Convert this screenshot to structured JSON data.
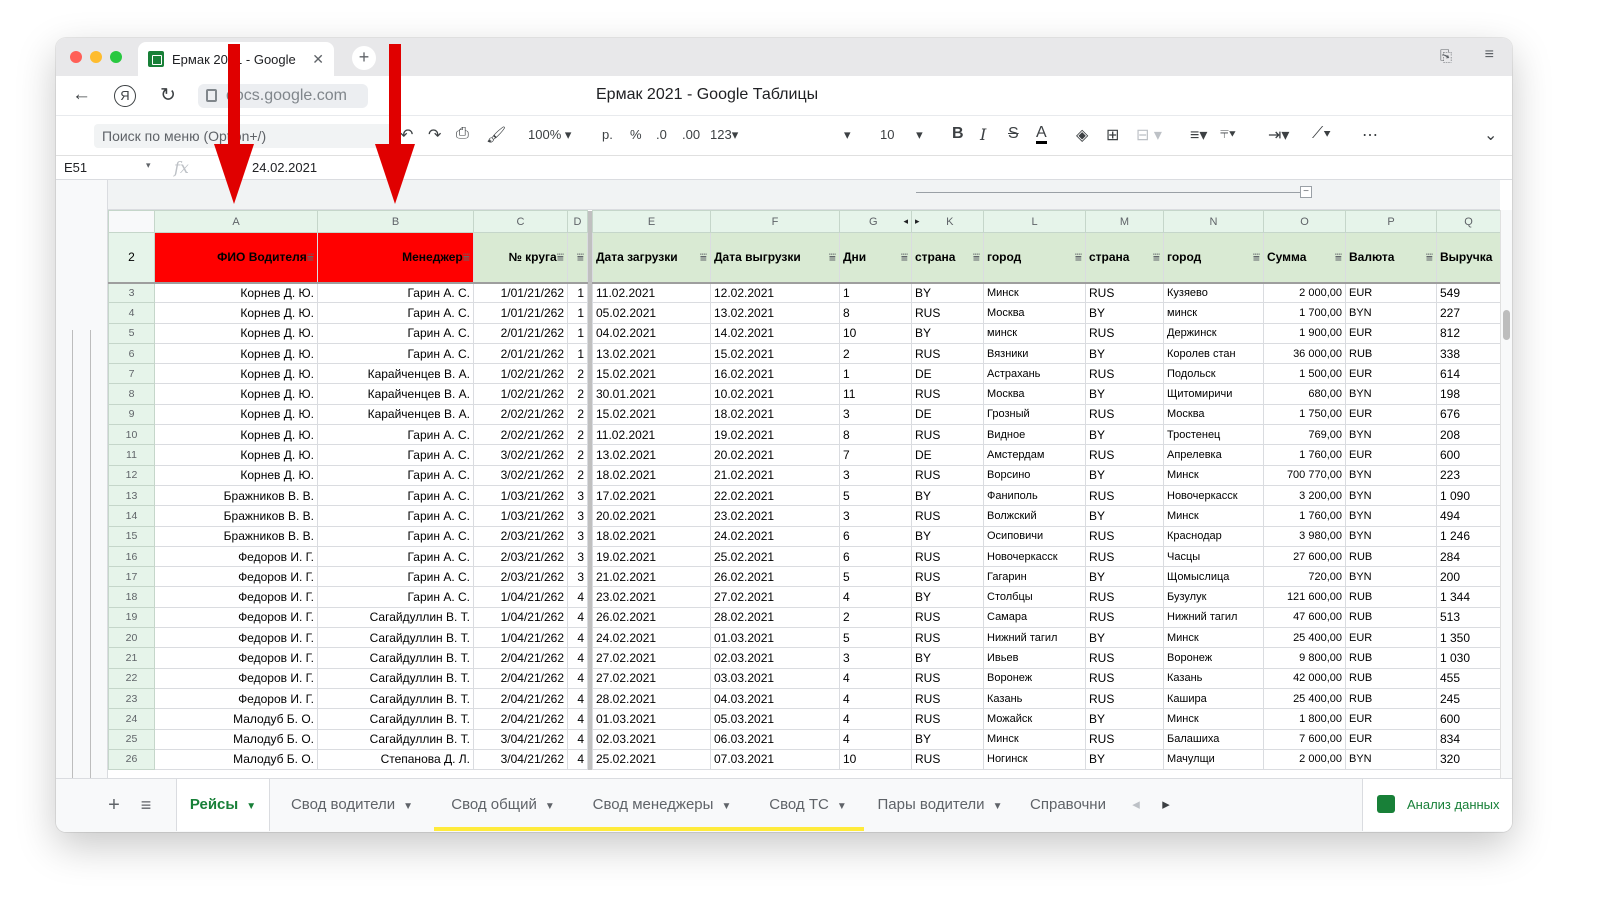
{
  "browser": {
    "tab_title": "Ермак 2021 - Google",
    "url": "docs.google.com",
    "page_title": "Ермак 2021 - Google Таблицы"
  },
  "toolbar": {
    "menu_search_placeholder": "Поиск по меню (Option+/)",
    "zoom": "100%",
    "currency": "р.",
    "percent": "%",
    "dec_decrease": ".0",
    "dec_increase": ".00",
    "number_format": "123",
    "font_size": "10"
  },
  "formula_bar": {
    "cell_ref": "E51",
    "fx": "fx",
    "value": "24.02.2021"
  },
  "colors": {
    "accent": "#188038",
    "highlight_header": "#ff0000",
    "header_fill": "#d9ead3",
    "arrow": "#e00000"
  },
  "sheet": {
    "columns": [
      "A",
      "B",
      "C",
      "D",
      "E",
      "F",
      "G",
      "K",
      "L",
      "M",
      "N",
      "O",
      "P",
      "Q"
    ],
    "headers": [
      "ФИО Водителя",
      "Менеджер",
      "№ круга",
      "",
      "Дата загрузки",
      "Дата выгрузки",
      "Дни",
      "страна",
      "город",
      "страна",
      "город",
      "Сумма",
      "Валюта",
      "Выручка"
    ],
    "header_row_number": "2",
    "rows": [
      {
        "n": "3",
        "a": "Корнев Д. Ю.",
        "b": "Гарин А. С.",
        "c": "1/01/21/262",
        "d": "1",
        "e": "11.02.2021",
        "f": "12.02.2021",
        "g": "1",
        "k": "BY",
        "l": "Минск",
        "m": "RUS",
        "nn": "Кузяево",
        "o": "2 000,00",
        "p": "EUR",
        "q": "549"
      },
      {
        "n": "4",
        "a": "Корнев Д. Ю.",
        "b": "Гарин А. С.",
        "c": "1/01/21/262",
        "d": "1",
        "e": "05.02.2021",
        "f": "13.02.2021",
        "g": "8",
        "k": "RUS",
        "l": "Москва",
        "m": "BY",
        "nn": "минск",
        "o": "1 700,00",
        "p": "BYN",
        "q": "227"
      },
      {
        "n": "5",
        "a": "Корнев Д. Ю.",
        "b": "Гарин А. С.",
        "c": "2/01/21/262",
        "d": "1",
        "e": "04.02.2021",
        "f": "14.02.2021",
        "g": "10",
        "k": "BY",
        "l": "минск",
        "m": "RUS",
        "nn": "Держинск",
        "o": "1 900,00",
        "p": "EUR",
        "q": "812"
      },
      {
        "n": "6",
        "a": "Корнев Д. Ю.",
        "b": "Гарин А. С.",
        "c": "2/01/21/262",
        "d": "1",
        "e": "13.02.2021",
        "f": "15.02.2021",
        "g": "2",
        "k": "RUS",
        "l": "Вязники",
        "m": "BY",
        "nn": "Королев стан",
        "o": "36 000,00",
        "p": "RUB",
        "q": "338"
      },
      {
        "n": "7",
        "a": "Корнев Д. Ю.",
        "b": "Карайченцев В. А.",
        "c": "1/02/21/262",
        "d": "2",
        "e": "15.02.2021",
        "f": "16.02.2021",
        "g": "1",
        "k": "DE",
        "l": "Астрахань",
        "m": "RUS",
        "nn": "Подольск",
        "o": "1 500,00",
        "p": "EUR",
        "q": "614"
      },
      {
        "n": "8",
        "a": "Корнев Д. Ю.",
        "b": "Карайченцев В. А.",
        "c": "1/02/21/262",
        "d": "2",
        "e": "30.01.2021",
        "f": "10.02.2021",
        "g": "11",
        "k": "RUS",
        "l": "Москва",
        "m": "BY",
        "nn": "Щитомиричи",
        "o": "680,00",
        "p": "BYN",
        "q": "198"
      },
      {
        "n": "9",
        "a": "Корнев Д. Ю.",
        "b": "Карайченцев В. А.",
        "c": "2/02/21/262",
        "d": "2",
        "e": "15.02.2021",
        "f": "18.02.2021",
        "g": "3",
        "k": "DE",
        "l": "Грозный",
        "m": "RUS",
        "nn": "Москва",
        "o": "1 750,00",
        "p": "EUR",
        "q": "676"
      },
      {
        "n": "10",
        "a": "Корнев Д. Ю.",
        "b": "Гарин А. С.",
        "c": "2/02/21/262",
        "d": "2",
        "e": "11.02.2021",
        "f": "19.02.2021",
        "g": "8",
        "k": "RUS",
        "l": "Видное",
        "m": "BY",
        "nn": "Тростенец",
        "o": "769,00",
        "p": "BYN",
        "q": "208"
      },
      {
        "n": "11",
        "a": "Корнев Д. Ю.",
        "b": "Гарин А. С.",
        "c": "3/02/21/262",
        "d": "2",
        "e": "13.02.2021",
        "f": "20.02.2021",
        "g": "7",
        "k": "DE",
        "l": "Амстердам",
        "m": "RUS",
        "nn": "Апрелевка",
        "o": "1 760,00",
        "p": "EUR",
        "q": "600"
      },
      {
        "n": "12",
        "a": "Корнев Д. Ю.",
        "b": "Гарин А. С.",
        "c": "3/02/21/262",
        "d": "2",
        "e": "18.02.2021",
        "f": "21.02.2021",
        "g": "3",
        "k": "RUS",
        "l": "Ворсино",
        "m": "BY",
        "nn": "Минск",
        "o": "700 770,00",
        "p": "BYN",
        "q": "223"
      },
      {
        "n": "13",
        "a": "Бражников В. В.",
        "b": "Гарин А. С.",
        "c": "1/03/21/262",
        "d": "3",
        "e": "17.02.2021",
        "f": "22.02.2021",
        "g": "5",
        "k": "BY",
        "l": "Фаниполь",
        "m": "RUS",
        "nn": "Новочеркасск",
        "o": "3 200,00",
        "p": "BYN",
        "q": "1 090"
      },
      {
        "n": "14",
        "a": "Бражников В. В.",
        "b": "Гарин А. С.",
        "c": "1/03/21/262",
        "d": "3",
        "e": "20.02.2021",
        "f": "23.02.2021",
        "g": "3",
        "k": "RUS",
        "l": "Волжский",
        "m": "BY",
        "nn": "Минск",
        "o": "1 760,00",
        "p": "BYN",
        "q": "494"
      },
      {
        "n": "15",
        "a": "Бражников В. В.",
        "b": "Гарин А. С.",
        "c": "2/03/21/262",
        "d": "3",
        "e": "18.02.2021",
        "f": "24.02.2021",
        "g": "6",
        "k": "BY",
        "l": "Осиповичи",
        "m": "RUS",
        "nn": "Краснодар",
        "o": "3 980,00",
        "p": "BYN",
        "q": "1 246"
      },
      {
        "n": "16",
        "a": "Федоров И. Г.",
        "b": "Гарин А. С.",
        "c": "2/03/21/262",
        "d": "3",
        "e": "19.02.2021",
        "f": "25.02.2021",
        "g": "6",
        "k": "RUS",
        "l": "Новочеркасск",
        "m": "RUS",
        "nn": "Часцы",
        "o": "27 600,00",
        "p": "RUB",
        "q": "284"
      },
      {
        "n": "17",
        "a": "Федоров И. Г.",
        "b": "Гарин А. С.",
        "c": "2/03/21/262",
        "d": "3",
        "e": "21.02.2021",
        "f": "26.02.2021",
        "g": "5",
        "k": "RUS",
        "l": "Гагарин",
        "m": "BY",
        "nn": "Щомыслица",
        "o": "720,00",
        "p": "BYN",
        "q": "200"
      },
      {
        "n": "18",
        "a": "Федоров И. Г.",
        "b": "Гарин А. С.",
        "c": "1/04/21/262",
        "d": "4",
        "e": "23.02.2021",
        "f": "27.02.2021",
        "g": "4",
        "k": "BY",
        "l": "Столбцы",
        "m": "RUS",
        "nn": "Бузулук",
        "o": "121 600,00",
        "p": "RUB",
        "q": "1 344"
      },
      {
        "n": "19",
        "a": "Федоров И. Г.",
        "b": "Сагайдуллин В. Т.",
        "c": "1/04/21/262",
        "d": "4",
        "e": "26.02.2021",
        "f": "28.02.2021",
        "g": "2",
        "k": "RUS",
        "l": "Самара",
        "m": "RUS",
        "nn": "Нижний тагил",
        "o": "47 600,00",
        "p": "RUB",
        "q": "513"
      },
      {
        "n": "20",
        "a": "Федоров И. Г.",
        "b": "Сагайдуллин В. Т.",
        "c": "1/04/21/262",
        "d": "4",
        "e": "24.02.2021",
        "f": "01.03.2021",
        "g": "5",
        "k": "RUS",
        "l": "Нижний тагил",
        "m": "BY",
        "nn": "Минск",
        "o": "25 400,00",
        "p": "EUR",
        "q": "1 350"
      },
      {
        "n": "21",
        "a": "Федоров И. Г.",
        "b": "Сагайдуллин В. Т.",
        "c": "2/04/21/262",
        "d": "4",
        "e": "27.02.2021",
        "f": "02.03.2021",
        "g": "3",
        "k": "BY",
        "l": "Ивьев",
        "m": "RUS",
        "nn": "Воронеж",
        "o": "9 800,00",
        "p": "RUB",
        "q": "1 030"
      },
      {
        "n": "22",
        "a": "Федоров И. Г.",
        "b": "Сагайдуллин В. Т.",
        "c": "2/04/21/262",
        "d": "4",
        "e": "27.02.2021",
        "f": "03.03.2021",
        "g": "4",
        "k": "RUS",
        "l": "Воронеж",
        "m": "RUS",
        "nn": "Казань",
        "o": "42 000,00",
        "p": "RUB",
        "q": "455"
      },
      {
        "n": "23",
        "a": "Федоров И. Г.",
        "b": "Сагайдуллин В. Т.",
        "c": "2/04/21/262",
        "d": "4",
        "e": "28.02.2021",
        "f": "04.03.2021",
        "g": "4",
        "k": "RUS",
        "l": "Казань",
        "m": "RUS",
        "nn": "Кашира",
        "o": "25 400,00",
        "p": "RUB",
        "q": "245"
      },
      {
        "n": "24",
        "a": "Малодуб Б. О.",
        "b": "Сагайдуллин В. Т.",
        "c": "2/04/21/262",
        "d": "4",
        "e": "01.03.2021",
        "f": "05.03.2021",
        "g": "4",
        "k": "RUS",
        "l": "Можайск",
        "m": "BY",
        "nn": "Минск",
        "o": "1 800,00",
        "p": "EUR",
        "q": "600"
      },
      {
        "n": "25",
        "a": "Малодуб Б. О.",
        "b": "Сагайдуллин В. Т.",
        "c": "3/04/21/262",
        "d": "4",
        "e": "02.03.2021",
        "f": "06.03.2021",
        "g": "4",
        "k": "BY",
        "l": "Минск",
        "m": "RUS",
        "nn": "Балашиха",
        "o": "7 600,00",
        "p": "EUR",
        "q": "834"
      },
      {
        "n": "26",
        "a": "Малодуб Б. О.",
        "b": "Степанова Д. Л.",
        "c": "3/04/21/262",
        "d": "4",
        "e": "25.02.2021",
        "f": "07.03.2021",
        "g": "10",
        "k": "RUS",
        "l": "Ногинск",
        "m": "BY",
        "nn": "Мачулщи",
        "o": "2 000,00",
        "p": "BYN",
        "q": "320"
      }
    ]
  },
  "sheet_tabs": {
    "add": "+",
    "list": "≡",
    "tabs": [
      "Рейсы",
      "Свод водители",
      "Свод общий",
      "Свод менеджеры",
      "Свод ТС",
      "Пары водители",
      "Справочни"
    ],
    "analysis": "Анализ данных"
  }
}
